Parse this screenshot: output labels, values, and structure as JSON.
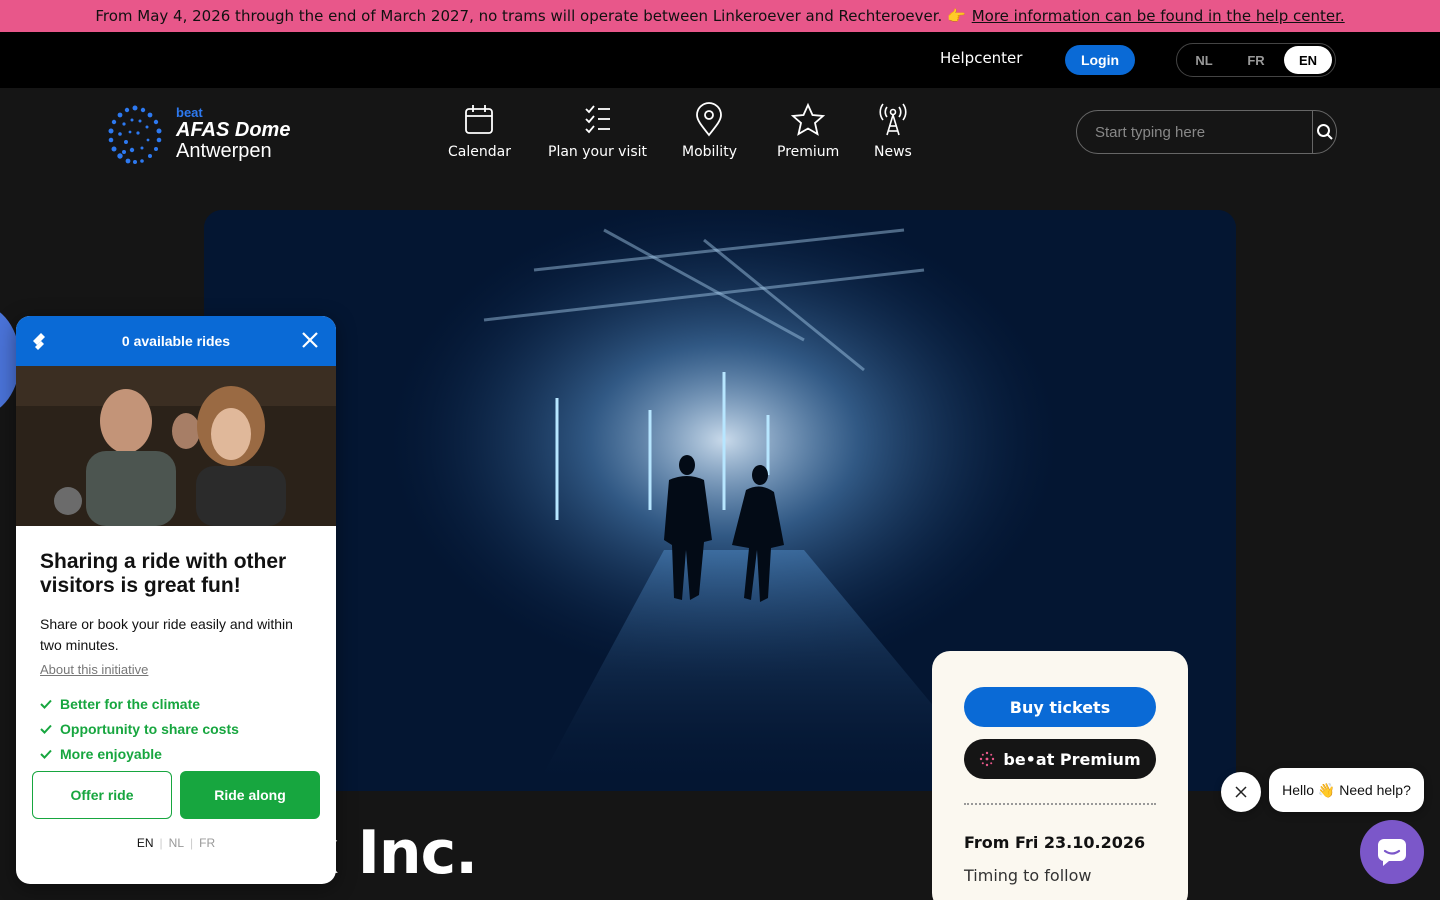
{
  "announcement": {
    "text": "From May 4, 2026 through the end of March 2027, no trams will operate between Linkeroever and Rechteroever. 👉",
    "link": "More information can be found in the help center."
  },
  "topbar": {
    "helpcenter": "Helpcenter",
    "login": "Login",
    "languages": [
      "NL",
      "FR",
      "EN"
    ],
    "active_language": "EN"
  },
  "logo": {
    "beat": "beat",
    "line1": "AFAS Dome",
    "line2": "Antwerpen"
  },
  "nav": [
    {
      "label": "Calendar",
      "icon": "calendar-icon"
    },
    {
      "label": "Plan your visit",
      "icon": "checklist-icon"
    },
    {
      "label": "Mobility",
      "icon": "map-pin-icon"
    },
    {
      "label": "Premium",
      "icon": "star-icon"
    },
    {
      "label": "News",
      "icon": "broadcast-tower-icon"
    }
  ],
  "search": {
    "placeholder": "Start typing here"
  },
  "event": {
    "title_visible": "x Inc."
  },
  "ticket": {
    "buy": "Buy tickets",
    "premium": "be•at Premium",
    "date": "From Fri 23.10.2026",
    "timing": "Timing to follow"
  },
  "ride": {
    "header": "0 available rides",
    "heading": "Sharing a ride with other visitors is great fun!",
    "description": "Share or book your ride easily and within two minutes.",
    "about_link": "About this initiative",
    "benefits": [
      "Better for the climate",
      "Opportunity to share costs",
      "More enjoyable"
    ],
    "offer": "Offer ride",
    "along": "Ride along",
    "languages": [
      "EN",
      "NL",
      "FR"
    ],
    "active_language": "EN"
  },
  "help": {
    "bubble_text": "Hello 👋 Need help?"
  },
  "colors": {
    "accent_blue": "#0a6ad6",
    "announce_pink": "#e8578a",
    "ride_green": "#17a63f",
    "chat_purple": "#7b57c9"
  }
}
